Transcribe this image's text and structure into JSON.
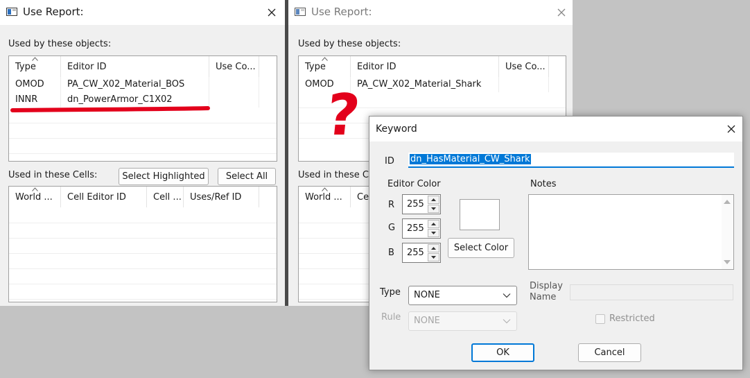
{
  "left_window": {
    "title": "Use Report:",
    "used_by_label": "Used by these objects:",
    "objects_table": {
      "columns": [
        "Type",
        "Editor ID",
        "Use Co..."
      ],
      "rows": [
        [
          "OMOD",
          "PA_CW_X02_Material_BOS",
          ""
        ],
        [
          "INNR",
          "dn_PowerArmor_C1X02",
          ""
        ]
      ]
    },
    "used_in_cells_label": "Used in these Cells:",
    "select_highlighted_label": "Select Highlighted",
    "select_all_label": "Select All",
    "cells_table": {
      "columns": [
        "World ...",
        "Cell Editor ID",
        "Cell ...",
        "Uses/Ref ID"
      ]
    },
    "annotation_color": "#e3001b"
  },
  "right_window": {
    "title": "Use Report:",
    "used_by_label": "Used by these objects:",
    "objects_table": {
      "columns": [
        "Type",
        "Editor ID",
        "Use Co..."
      ],
      "rows": [
        [
          "OMOD",
          "PA_CW_X02_Material_Shark",
          ""
        ]
      ]
    },
    "used_in_cells_label": "Used in these Ce",
    "cells_table": {
      "columns": [
        "World ...",
        "Ce"
      ]
    },
    "question_mark": "?"
  },
  "keyword_dialog": {
    "title": "Keyword",
    "id_label": "ID",
    "id_value": "dn_HasMaterial_CW_Shark",
    "editor_color_label": "Editor Color",
    "r_label": "R",
    "g_label": "G",
    "b_label": "B",
    "r_value": "255",
    "g_value": "255",
    "b_value": "255",
    "swatch_color": "#ffffff",
    "select_color_label": "Select Color",
    "notes_label": "Notes",
    "type_label": "Type",
    "type_value": "NONE",
    "rule_label": "Rule",
    "rule_value": "NONE",
    "display_name_label": "Display\nName",
    "restricted_label": "Restricted",
    "ok_label": "OK",
    "cancel_label": "Cancel",
    "selection_color": "#0078d7"
  }
}
